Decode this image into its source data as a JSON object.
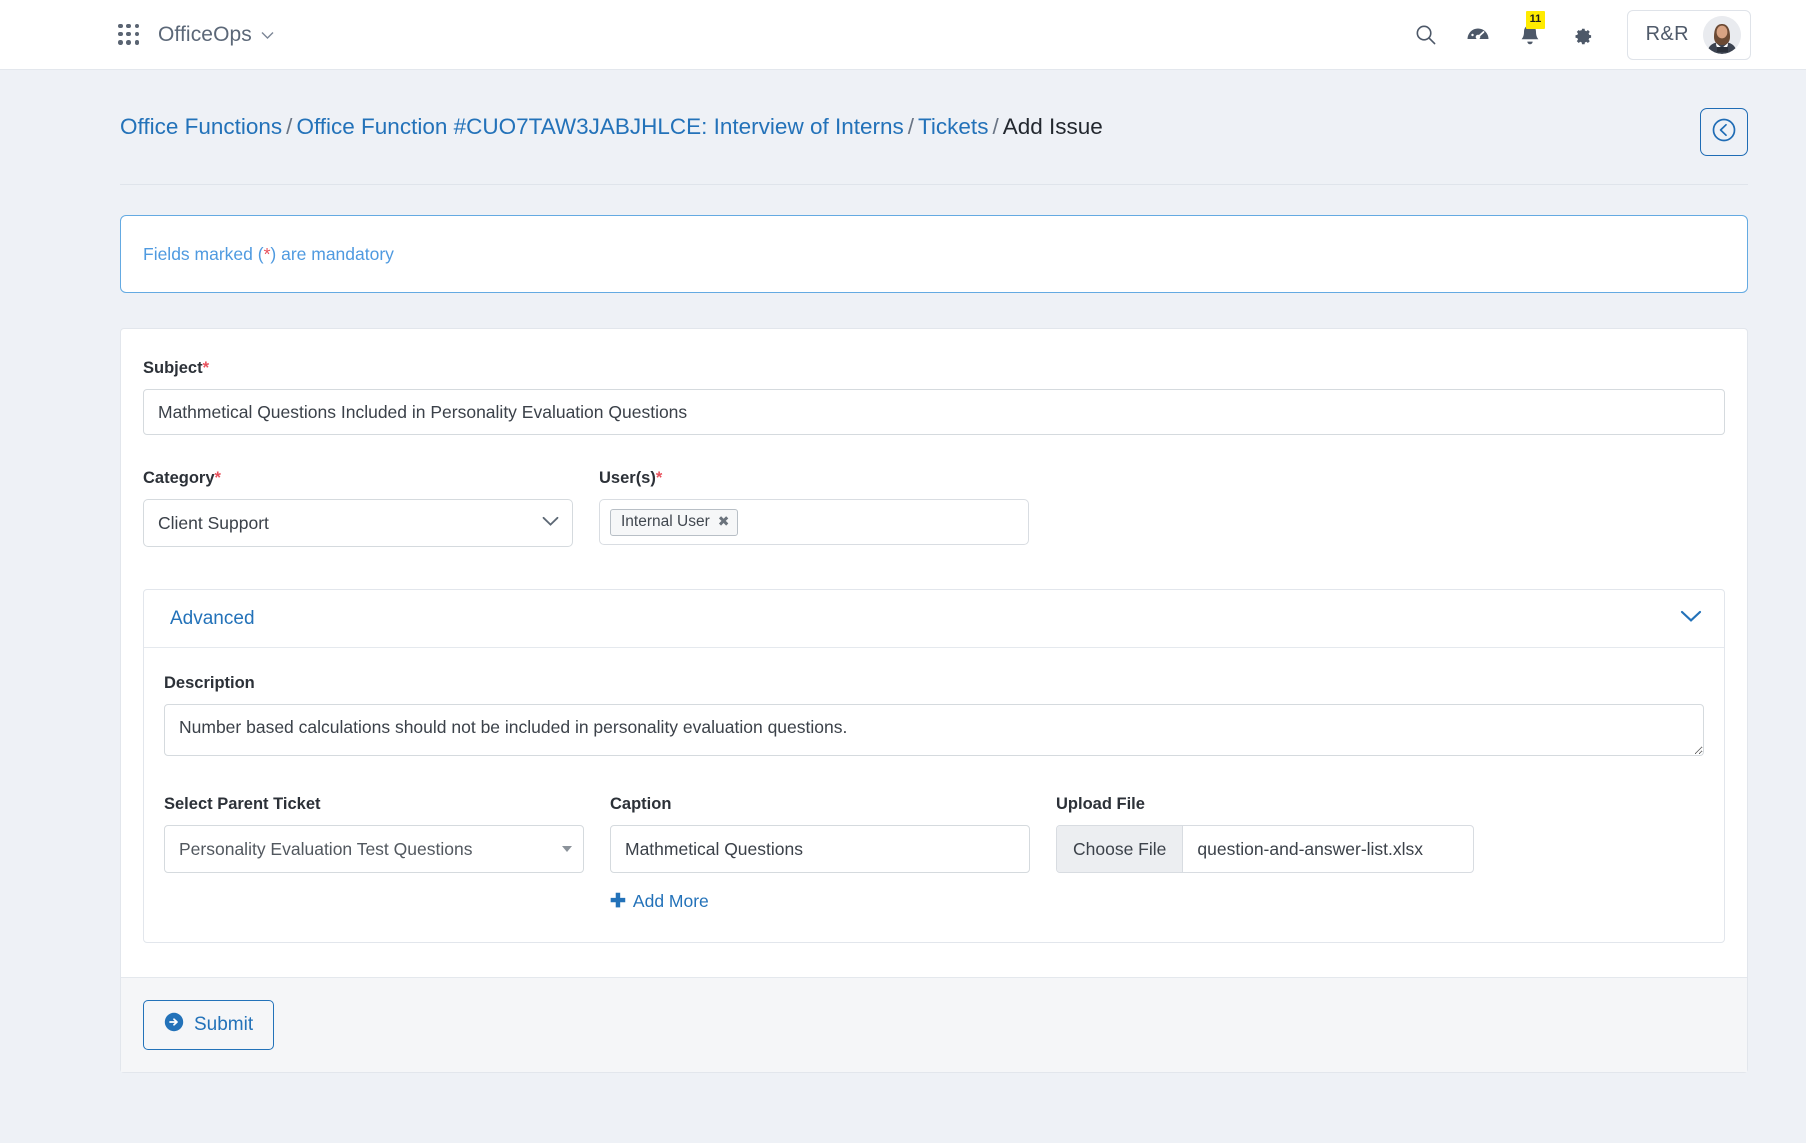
{
  "navbar": {
    "apps_icon": "apps-grid-icon",
    "brand": "OfficeOps",
    "brand_caret": "∨",
    "search_icon": "search-icon",
    "dashboard_icon": "speedometer-icon",
    "bell_icon": "bell-icon",
    "notification_count": "11",
    "settings_icon": "gear-icon",
    "user_initials": "R&R",
    "avatar": "user-avatar"
  },
  "breadcrumb": {
    "item1": "Office Functions",
    "item2": "Office Function #CUO7TAW3JABJHLCE: Interview of Interns",
    "item3": "Tickets",
    "current": "Add Issue",
    "separator": "/",
    "back_icon": "circle-chevron-left-icon"
  },
  "notice": {
    "prefix": "Fields marked (",
    "star": "*",
    "suffix": ") are mandatory"
  },
  "form": {
    "subject": {
      "label": "Subject",
      "required": "*",
      "value": "Mathmetical Questions Included in Personality Evaluation Questions",
      "placeholder": "Subject"
    },
    "category": {
      "label": "Category",
      "required": "*",
      "value": "Client Support",
      "options": [
        "Client Support"
      ],
      "chevron_icon": "chevron-down-icon"
    },
    "users": {
      "label": "User(s)",
      "required": "*",
      "tags": [
        "Internal User"
      ],
      "remove_icon": "✖"
    },
    "advanced": {
      "title": "Advanced",
      "chevron_icon": "chevron-down-icon",
      "description": {
        "label": "Description",
        "value": "Number based calculations should not be included in personality evaluation questions.",
        "placeholder": "Description"
      },
      "parent_ticket": {
        "label": "Select Parent Ticket",
        "value": "Personality Evaluation Test Questions",
        "caret_icon": "caret-down-icon"
      },
      "caption": {
        "label": "Caption",
        "value": "Mathmetical Questions",
        "placeholder": "Caption"
      },
      "upload": {
        "label": "Upload File",
        "button": "Choose File",
        "filename": "question-and-answer-list.xlsx"
      },
      "add_more": {
        "label": "Add More",
        "plus_icon": "plus-icon"
      }
    },
    "submit": {
      "label": "Submit",
      "icon": "arrow-right-circle-icon"
    }
  },
  "colors": {
    "link": "#2372b9",
    "required": "#e8505b",
    "notice_border": "#64aae2",
    "badge_bg": "#ffeb00",
    "page_bg": "#eef1f6"
  }
}
